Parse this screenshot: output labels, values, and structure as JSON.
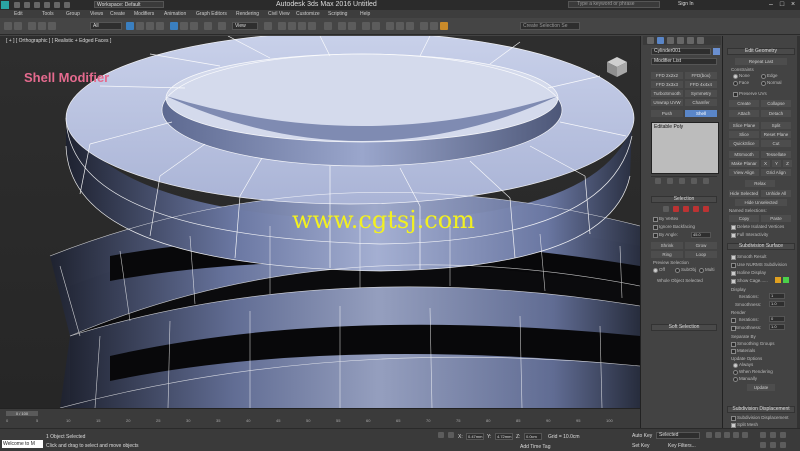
{
  "app": {
    "title": "Autodesk 3ds Max 2016   Untitled",
    "workspace": "Workspace: Default",
    "search_placeholder": "Type a keyword or phrase",
    "signin": "Sign In"
  },
  "menu": [
    "Edit",
    "Tools",
    "Group",
    "Views",
    "Create",
    "Modifiers",
    "Animation",
    "Graph Editors",
    "Rendering",
    "Civil View",
    "Customize",
    "Scripting",
    "Help"
  ],
  "toolbar": {
    "selection_filter": "All",
    "view_dropdown": "View",
    "selection_set": "Create Selection Se"
  },
  "viewport": {
    "label": "[ + ] [ Orthographic ] [ Realistic + Edged Faces ]",
    "overlay_title": "Shell Modifier",
    "watermark": "www.cgtsj.com"
  },
  "timeline": {
    "slider": "0 / 100",
    "ticks": [
      "0",
      "5",
      "10",
      "15",
      "20",
      "25",
      "30",
      "35",
      "40",
      "45",
      "50",
      "55",
      "60",
      "65",
      "70",
      "75",
      "80",
      "85",
      "90",
      "95",
      "100"
    ]
  },
  "status": {
    "listener": "Welcome to M",
    "line1": "1 Object Selected",
    "line2": "Click and drag to select and move objects",
    "x_label": "X:",
    "x_value": "0.47mm",
    "y_label": "Y:",
    "y_value": "4.72mm",
    "z_label": "Z:",
    "z_value": "0.0cm",
    "grid": "Grid = 10.0cm",
    "add_time_tag": "Add Time Tag",
    "auto_key": "Auto Key",
    "auto_key_value": "Selected",
    "set_key": "Set Key",
    "key_filters": "Key Filters..."
  },
  "panel1": {
    "object_name": "Cylinder001",
    "modifier_list": "Modifier List",
    "buttons": [
      [
        "FFD 2x2x2",
        "FFD(box)"
      ],
      [
        "FFD 3x3x3",
        "FFD 4x4x4"
      ],
      [
        "TurboSmooth",
        "Symmetry"
      ],
      [
        "Unwrap UVW",
        "Chamfer"
      ],
      [
        "Push",
        "Shell"
      ]
    ],
    "stack_item": "Editable Poly",
    "selection_header": "Selection",
    "by_vertex": "By Vertex",
    "ignore_backfacing": "Ignore Backfacing",
    "by_angle": "By Angle:",
    "by_angle_value": "45.0",
    "shrink": "Shrink",
    "grow": "Grow",
    "ring": "Ring",
    "loop": "Loop",
    "preview_header": "Preview Selection",
    "preview_off": "Off",
    "preview_subobj": "SubObj",
    "preview_multi": "Multi",
    "whole_object": "Whole Object Selected",
    "soft_selection": "Soft Selection"
  },
  "panel2": {
    "edit_geometry": "Edit Geometry",
    "repeat_last": "Repeat Last",
    "constraints": "Constraints",
    "c_none": "None",
    "c_edge": "Edge",
    "c_face": "Face",
    "c_normal": "Normal",
    "preserve_uvs": "Preserve UVs",
    "create": "Create",
    "collapse": "Collapse",
    "attach": "Attach",
    "detach": "Detach",
    "slice_plane": "Slice Plane",
    "split": "Split",
    "slice": "Slice",
    "reset_plane": "Reset Plane",
    "quickslice": "QuickSlice",
    "cut": "Cut",
    "msmooth": "MSmooth",
    "tessellate": "Tessellate",
    "make_planar": "Make Planar",
    "x": "X",
    "y": "Y",
    "z": "Z",
    "view_align": "View Align",
    "grid_align": "Grid Align",
    "relax": "Relax",
    "hide_selected": "Hide Selected",
    "unhide_all": "Unhide All",
    "hide_unselected": "Hide Unselected",
    "named_selections": "Named Selections:",
    "copy": "Copy",
    "paste": "Paste",
    "delete_isolated": "Delete Isolated Vertices",
    "full_interactivity": "Full Interactivity",
    "subdivision_surface": "Subdivision Surface",
    "smooth_result": "Smooth Result",
    "use_nurms": "Use NURMS Subdivision",
    "isoline_display": "Isoline Display",
    "show_cage": "Show Cage......",
    "display": "Display",
    "iterations": "Iterations:",
    "iterations_value": "1",
    "smoothness": "Smoothness:",
    "smoothness_value": "1.0",
    "render": "Render",
    "r_iterations": "Iterations:",
    "r_iterations_value": "0",
    "r_smoothness": "Smoothness:",
    "r_smoothness_value": "1.0",
    "separate_by": "Separate By",
    "smoothing_groups": "Smoothing Groups",
    "materials": "Materials",
    "update_options": "Update Options",
    "always": "Always",
    "when_rendering": "When Rendering",
    "manually": "Manually",
    "update": "Update",
    "subdivision_displacement": "Subdivision Displacement",
    "sub_disp_check": "Subdivision Displacement",
    "split_mesh": "Split Mesh"
  },
  "colors": {
    "accent": "#5a86c8",
    "overlay_title": "#e46a8e",
    "watermark": "#f2f020",
    "cage_orange": "#e0a020",
    "cage_green": "#4ad04a"
  }
}
